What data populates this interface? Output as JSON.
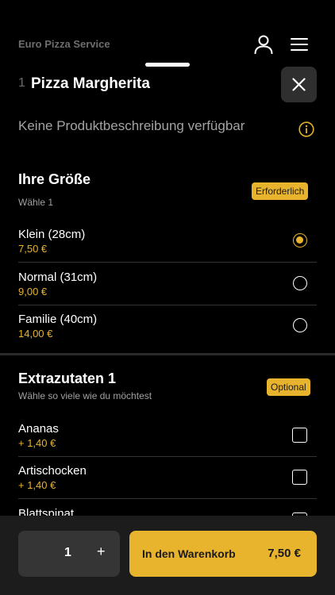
{
  "header": {
    "app_title": "Euro Pizza Service"
  },
  "product": {
    "quantity_prefix": "1",
    "name": "Pizza Margherita",
    "description": "Keine Produktbeschreibung verfügbar"
  },
  "size_section": {
    "title": "Ihre Größe",
    "subtitle": "Wähle 1",
    "badge": "Erforderlich",
    "options": [
      {
        "label": "Klein (28cm)",
        "price": "7,50 €",
        "selected": true
      },
      {
        "label": "Normal (31cm)",
        "price": "9,00 €",
        "selected": false
      },
      {
        "label": "Familie (40cm)",
        "price": "14,00 €",
        "selected": false
      }
    ]
  },
  "extras_section": {
    "title": "Extrazutaten 1",
    "subtitle": "Wähle so viele wie du möchtest",
    "badge": "Optional",
    "options": [
      {
        "label": "Ananas",
        "price": "+ 1,40 €",
        "checked": false
      },
      {
        "label": "Artischocken",
        "price": "+ 1,40 €",
        "checked": false
      },
      {
        "label": "Blattspinat",
        "price": "",
        "checked": false
      }
    ]
  },
  "bottom_bar": {
    "quantity": "1",
    "plus_label": "+",
    "cart_label": "In den Warenkorb",
    "cart_price": "7,50 €"
  },
  "colors": {
    "accent": "#e8b32d",
    "background": "#000000",
    "panel": "#1c1c1c"
  },
  "icons": [
    "user-icon",
    "menu-icon",
    "close-icon",
    "info-icon"
  ]
}
